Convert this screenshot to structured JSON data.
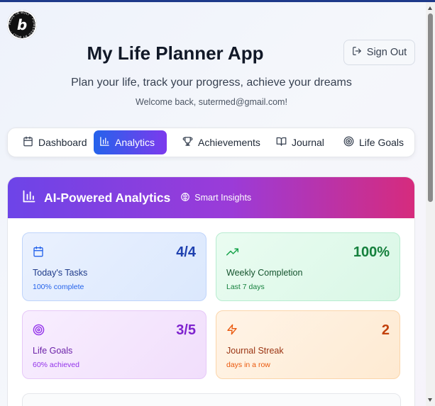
{
  "app": {
    "title": "My Life Planner App",
    "subtitle": "Plan your life, track your progress, achieve your dreams",
    "welcome": "Welcome back, sutermed@gmail.com!",
    "sign_out_label": "Sign Out",
    "badge_letter": "b",
    "badge_ring_text": "MADE IN BOLT · POWERED BY BOLT ·"
  },
  "tabs": [
    {
      "label": "Dashboard",
      "icon": "calendar-icon",
      "active": false
    },
    {
      "label": "Analytics",
      "icon": "bar-chart-icon",
      "active": true
    },
    {
      "label": "Achievements",
      "icon": "trophy-icon",
      "active": false
    },
    {
      "label": "Journal",
      "icon": "book-open-icon",
      "active": false
    },
    {
      "label": "Life Goals",
      "icon": "target-icon",
      "active": false
    }
  ],
  "analytics": {
    "title": "AI-Powered Analytics",
    "insights_label": "Smart Insights",
    "cards": [
      {
        "value": "4/4",
        "label": "Today's Tasks",
        "sub": "100% complete",
        "icon": "calendar-icon",
        "accent": "#2563eb"
      },
      {
        "value": "100%",
        "label": "Weekly Completion",
        "sub": "Last 7 days",
        "icon": "trending-up-icon",
        "accent": "#16a34a"
      },
      {
        "value": "3/5",
        "label": "Life Goals",
        "sub": "60% achieved",
        "icon": "target-icon",
        "accent": "#9333ea"
      },
      {
        "value": "2",
        "label": "Journal Streak",
        "sub": "days in a row",
        "icon": "lightning-icon",
        "accent": "#ea580c"
      }
    ]
  },
  "colors": {
    "header_gradient_start": "#6d44e8",
    "header_gradient_end": "#d62b7d",
    "active_tab_start": "#2563eb",
    "active_tab_end": "#7c3aed"
  }
}
